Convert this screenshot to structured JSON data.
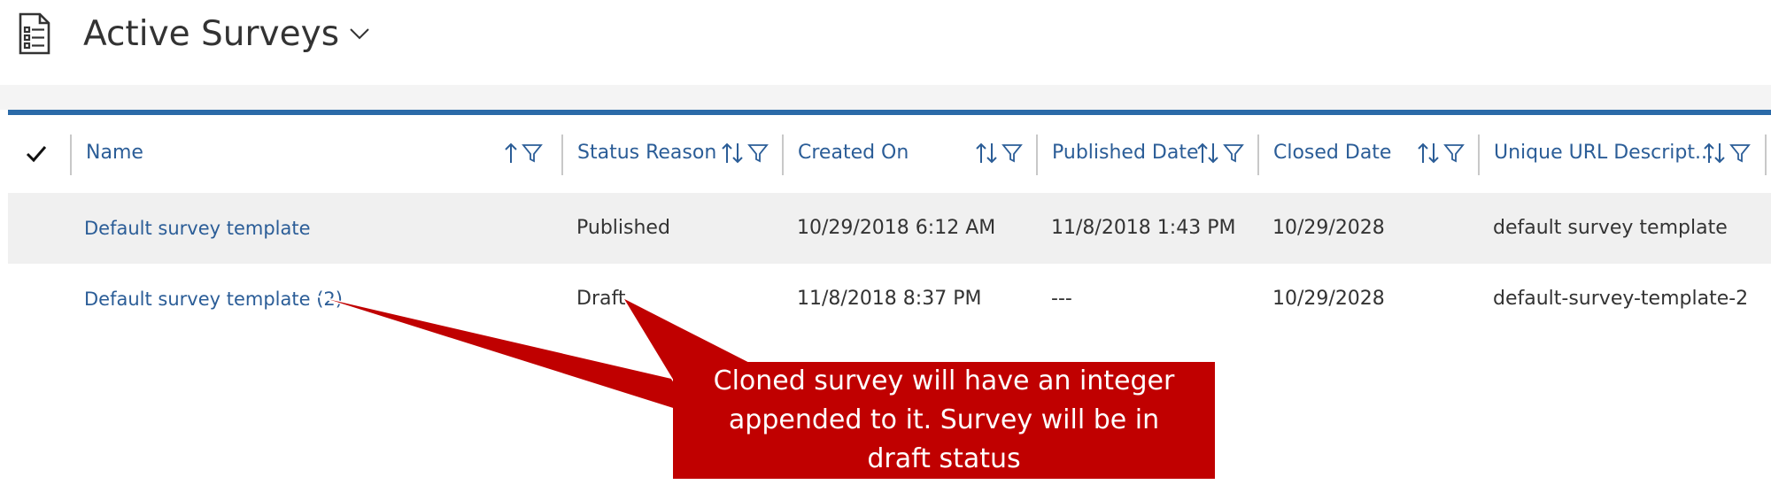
{
  "header": {
    "title": "Active Surveys",
    "title_icon": "survey-document-icon",
    "view_selector_icon": "chevron-down-icon"
  },
  "grid": {
    "select_all_icon": "checkmark-icon",
    "columns": [
      {
        "label": "Name",
        "sort_icon": "sort-ascending-icon",
        "filter_icon": "filter-icon"
      },
      {
        "label": "Status Reason",
        "sort_icon": "sort-icon",
        "filter_icon": "filter-icon"
      },
      {
        "label": "Created On",
        "sort_icon": "sort-icon",
        "filter_icon": "filter-icon"
      },
      {
        "label": "Published Date",
        "sort_icon": "sort-icon",
        "filter_icon": "filter-icon"
      },
      {
        "label": "Closed Date",
        "sort_icon": "sort-icon",
        "filter_icon": "filter-icon"
      },
      {
        "label": "Unique URL Descript...",
        "sort_icon": "sort-icon",
        "filter_icon": "filter-icon"
      }
    ],
    "rows": [
      {
        "name": "Default survey template",
        "status_reason": "Published",
        "created_on": "10/29/2018 6:12 AM",
        "published_date": "11/8/2018 1:43 PM",
        "closed_date": "10/29/2028",
        "unique_url": "default survey template"
      },
      {
        "name": "Default survey template (2)",
        "status_reason": "Draft",
        "created_on": "11/8/2018 8:37 PM",
        "published_date": "---",
        "closed_date": "10/29/2028",
        "unique_url": "default-survey-template-2"
      }
    ]
  },
  "annotation": {
    "text": "Cloned survey will have an integer appended to it.  Survey will be in draft status",
    "color": "#c00000"
  },
  "colors": {
    "accent_line": "#2b6aa8",
    "link_text": "#2b5d97",
    "alt_row": "#f0f0f0"
  }
}
